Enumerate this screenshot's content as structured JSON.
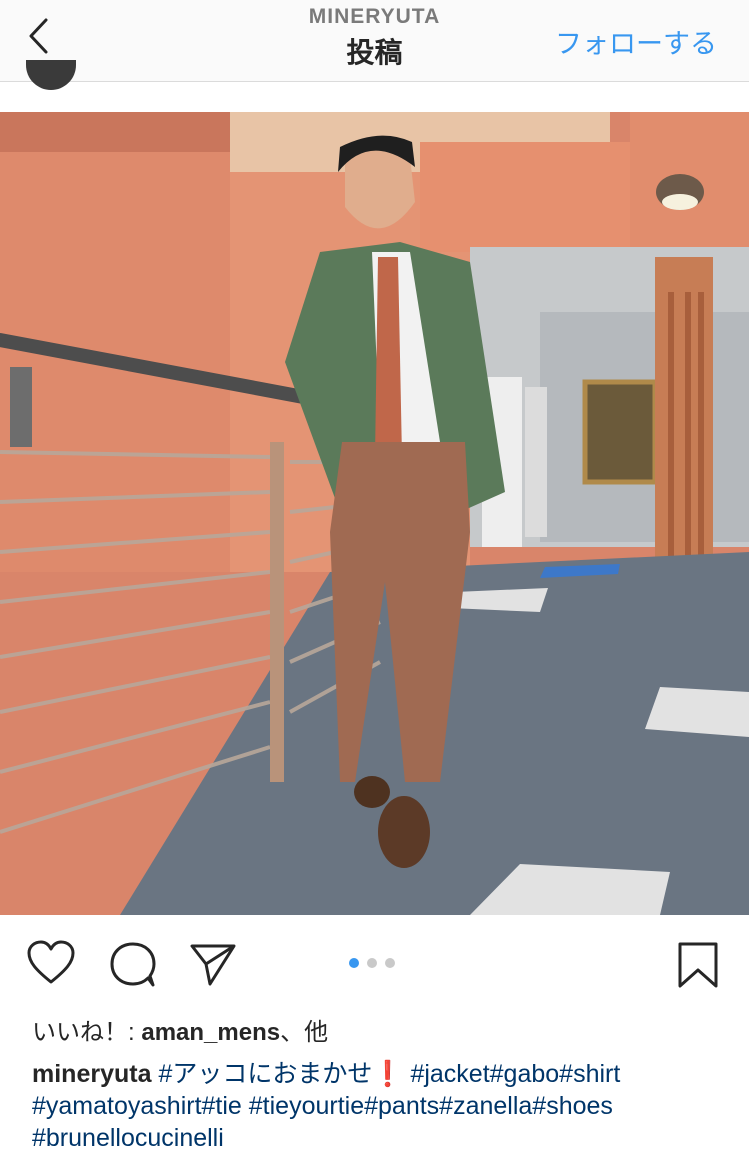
{
  "header": {
    "username": "MINERYUTA",
    "title": "投稿",
    "follow_label": "フォローする"
  },
  "post": {
    "carousel": {
      "count": 3,
      "active": 1
    }
  },
  "likes": {
    "prefix": "いいね！: ",
    "user": "aman_mens",
    "suffix": "、他"
  },
  "caption": {
    "user": "mineryuta",
    "tag1": "#アッコにおまかせ",
    "excl": "❗",
    "tags_line1": "#jacket#gabo#shirt",
    "tags_line2": "#yamatoyashirt#tie #tieyourtie#pants#zanella#shoes",
    "tags_line3": "#brunellocucinelli"
  },
  "colors": {
    "accent": "#3897f0",
    "hashtag": "#003569",
    "wall": "#de8a6c",
    "carpet": "#6a7582"
  },
  "icons": [
    "chevron-left-icon",
    "heart-icon",
    "comment-icon",
    "send-icon",
    "bookmark-icon"
  ]
}
